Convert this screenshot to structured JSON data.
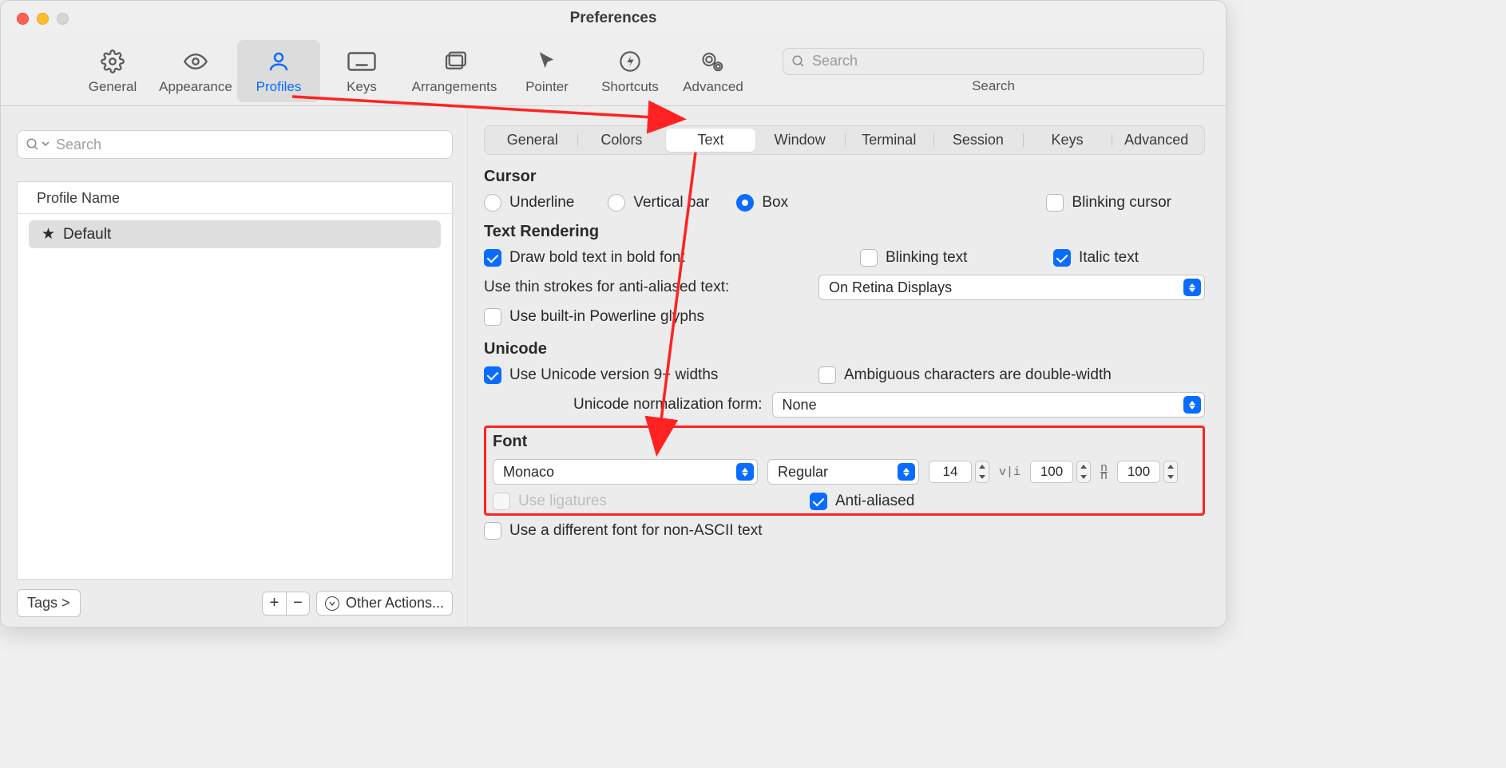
{
  "window": {
    "title": "Preferences"
  },
  "toolbar": {
    "items": [
      {
        "label": "General"
      },
      {
        "label": "Appearance"
      },
      {
        "label": "Profiles"
      },
      {
        "label": "Keys"
      },
      {
        "label": "Arrangements"
      },
      {
        "label": "Pointer"
      },
      {
        "label": "Shortcuts"
      },
      {
        "label": "Advanced"
      }
    ],
    "search_placeholder": "Search",
    "search_label": "Search"
  },
  "left": {
    "search_placeholder": "Search",
    "list_header": "Profile Name",
    "profiles": [
      {
        "name": "Default"
      }
    ],
    "tags_btn": "Tags >",
    "other_actions": "Other Actions..."
  },
  "tabs": {
    "items": [
      "General",
      "Colors",
      "Text",
      "Window",
      "Terminal",
      "Session",
      "Keys",
      "Advanced"
    ],
    "active_index": 2
  },
  "cursor": {
    "title": "Cursor",
    "underline": "Underline",
    "vertical": "Vertical bar",
    "box": "Box",
    "blinking": "Blinking cursor"
  },
  "text_rendering": {
    "title": "Text Rendering",
    "bold": "Draw bold text in bold font",
    "blinking_text": "Blinking text",
    "italic": "Italic text",
    "thin_strokes_label": "Use thin strokes for anti-aliased text:",
    "thin_strokes_value": "On Retina Displays",
    "powerline": "Use built-in Powerline glyphs"
  },
  "unicode": {
    "title": "Unicode",
    "v9": "Use Unicode version 9+ widths",
    "ambiguous": "Ambiguous characters are double-width",
    "norm_label": "Unicode normalization form:",
    "norm_value": "None"
  },
  "font": {
    "title": "Font",
    "family": "Monaco",
    "weight": "Regular",
    "size": "14",
    "hspacing": "100",
    "vspacing": "100",
    "hspacing_icon": "v|i",
    "vspacing_icon": "n/n",
    "ligatures": "Use ligatures",
    "anti_aliased": "Anti-aliased",
    "non_ascii": "Use a different font for non-ASCII text"
  }
}
